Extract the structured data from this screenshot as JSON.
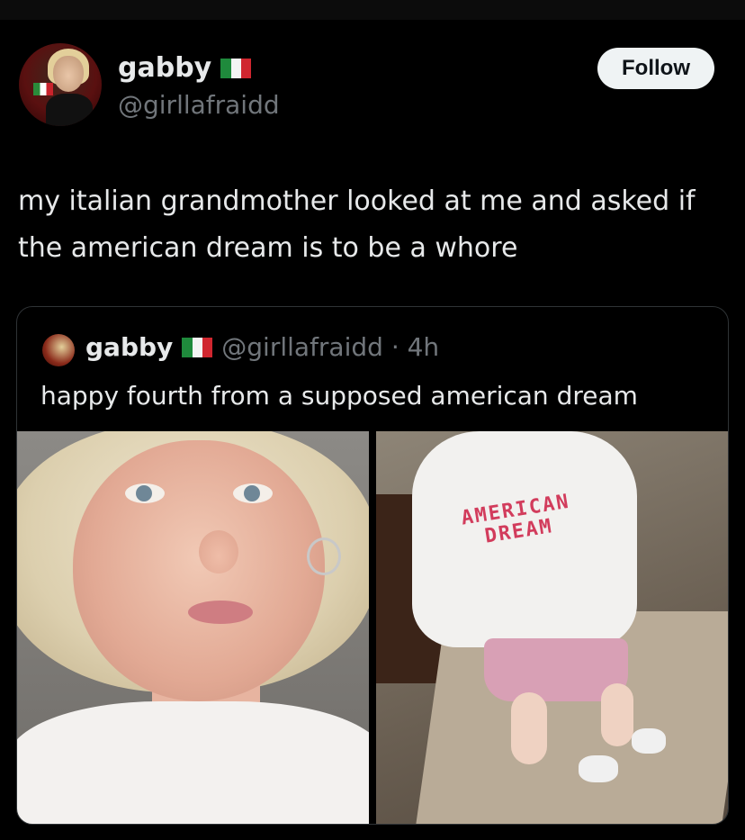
{
  "author": {
    "name": "gabby",
    "handle": "@girllafraidd",
    "flag_icon": "italy-flag-icon"
  },
  "follow_button": {
    "label": "Follow"
  },
  "tweet": {
    "text": "my italian grandmother looked at me and asked if the american dream is to be a whore"
  },
  "quoted_tweet": {
    "name": "gabby",
    "handle_time": "@girllafraidd · 4h",
    "text": "happy fourth from a supposed american dream",
    "shirt_text": "AMERICAN DREAM"
  },
  "colors": {
    "background": "#000000",
    "text": "#e7e9ea",
    "muted": "#71767b",
    "button_bg": "#eff3f4",
    "border": "#2f3336"
  }
}
